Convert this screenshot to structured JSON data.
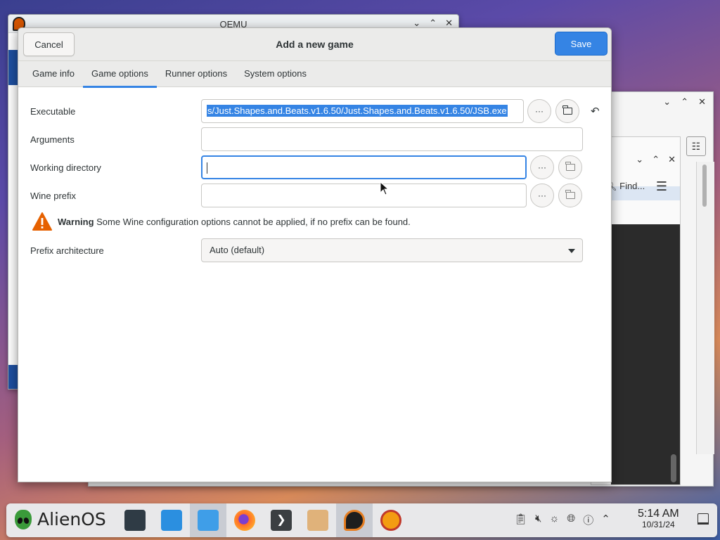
{
  "background": {
    "qemu_window_title": "QEMU",
    "find_label": "Find..."
  },
  "dialog": {
    "title": "Add a new game",
    "cancel_label": "Cancel",
    "save_label": "Save",
    "accent_color": "#3584e4"
  },
  "tabs": [
    {
      "label": "Game info",
      "active": false
    },
    {
      "label": "Game options",
      "active": true
    },
    {
      "label": "Runner options",
      "active": false
    },
    {
      "label": "System options",
      "active": false
    }
  ],
  "form": {
    "executable": {
      "label": "Executable",
      "value": "s/Just.Shapes.and.Beats.v1.6.50/Just.Shapes.and.Beats.v1.6.50/JSB.exe",
      "selected": true
    },
    "arguments": {
      "label": "Arguments",
      "value": ""
    },
    "working_directory": {
      "label": "Working directory",
      "value": "",
      "focused": true
    },
    "wine_prefix": {
      "label": "Wine prefix",
      "value": ""
    },
    "browse_label": "···",
    "warning": {
      "title": "Warning",
      "text": "Some Wine configuration options cannot be applied, if no prefix can be found."
    },
    "prefix_architecture": {
      "label": "Prefix architecture",
      "value": "Auto (default)"
    }
  },
  "taskbar": {
    "start_label": "AlienOS",
    "apps": [
      "settings-app",
      "store-app",
      "files-app",
      "firefox-app",
      "terminal-app",
      "archive-app",
      "lutris-app",
      "lutris-alt-app"
    ],
    "time": "5:14 AM",
    "date": "10/31/24"
  }
}
